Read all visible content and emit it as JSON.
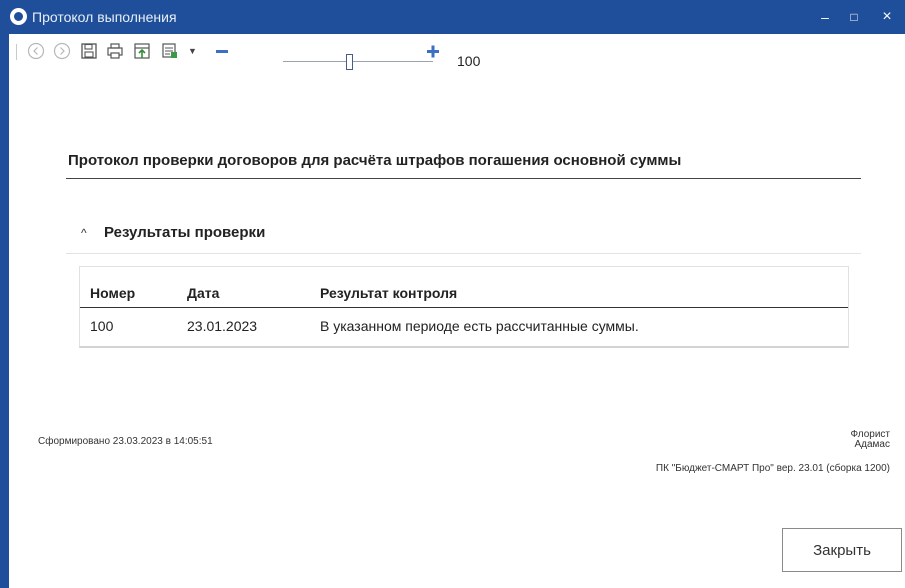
{
  "window": {
    "title": "Протокол выполнения",
    "controls": {
      "minimize": "–",
      "maximize": "□",
      "close": "×"
    }
  },
  "toolbar": {
    "icons": [
      "back-icon",
      "forward-icon",
      "save-icon",
      "print-icon",
      "export-icon",
      "export-format-icon",
      "dropdown-arrow-icon",
      "zoom-out-icon",
      "zoom-in-icon"
    ],
    "zoom": {
      "value": "100",
      "min_symbol": "−",
      "max_symbol": "+"
    }
  },
  "report": {
    "title": "Протокол проверки договоров для расчёта штрафов погашения основной суммы",
    "section": {
      "title": "Результаты проверки",
      "expanded": true
    },
    "table": {
      "columns": [
        "Номер",
        "Дата",
        "Результат контроля"
      ],
      "rows": [
        [
          "100",
          "23.01.2023",
          "В указанном периоде есть рассчитанные суммы."
        ]
      ]
    }
  },
  "footer": {
    "generated": "Сформировано 23.03.2023 в 14:05:51",
    "user_line1": "Флорист",
    "user_line2": "Адамас",
    "version": "ПК \"Бюджет-СМАРТ Про\" вер. 23.01 (сборка 1200)"
  },
  "buttons": {
    "close": "Закрыть"
  },
  "colors": {
    "titlebar": "#1f4f9a",
    "text": "#222222"
  }
}
